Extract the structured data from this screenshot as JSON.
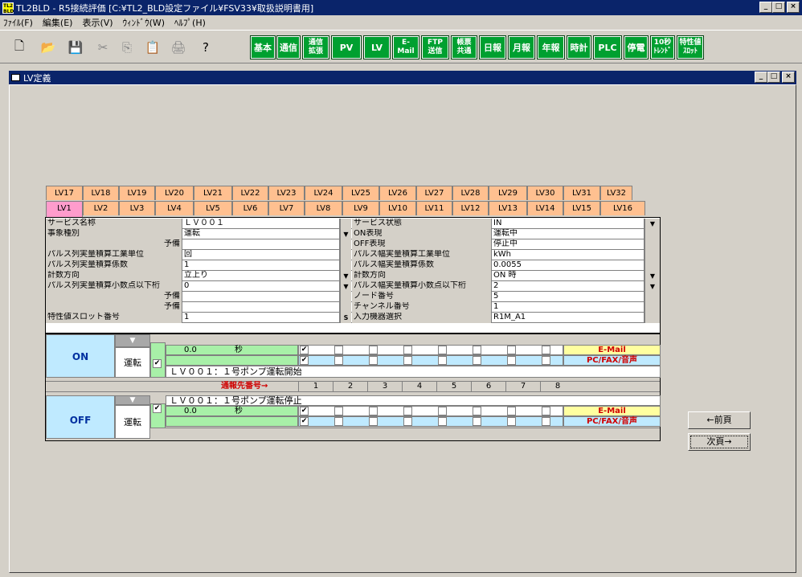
{
  "window": {
    "title": "TL2BLD - R5接続評価 [C:¥TL2_BLD設定ファイル¥FSV33¥取扱説明書用]",
    "icon_text": "TL2 BLD"
  },
  "menu": [
    "ﾌｧｲﾙ(F)",
    "編集(E)",
    "表示(V)",
    "ｳｨﾝﾄﾞｳ(W)",
    "ﾍﾙﾌﾟ(H)"
  ],
  "toolbar": {
    "icons": [
      "new-file-icon",
      "open-folder-icon",
      "save-icon",
      "cut-icon",
      "copy-icon",
      "paste-icon",
      "print-icon",
      "help-icon"
    ],
    "buttons": [
      "基本",
      "通信",
      "通信\n拡張",
      "PV",
      "LV",
      "E-\nMail",
      "FTP\n送信",
      "帳票\n共通",
      "日報",
      "月報",
      "年報",
      "時計",
      "PLC",
      "停電",
      "10秒\nﾄﾚﾝﾄﾞ",
      "特性値\nｽﾛｯﾄ"
    ]
  },
  "subwindow": {
    "title": "LV定義"
  },
  "tabs_top": [
    "LV17",
    "LV18",
    "LV19",
    "LV20",
    "LV21",
    "LV22",
    "LV23",
    "LV24",
    "LV25",
    "LV26",
    "LV27",
    "LV28",
    "LV29",
    "LV30",
    "LV31",
    "LV32"
  ],
  "tabs_bottom": [
    "LV1",
    "LV2",
    "LV3",
    "LV4",
    "LV5",
    "LV6",
    "LV7",
    "LV8",
    "LV9",
    "LV10",
    "LV11",
    "LV12",
    "LV13",
    "LV14",
    "LV15",
    "LV16"
  ],
  "left_rows": [
    {
      "label": "サービス名称",
      "value": "ＬＶ００１",
      "dd": false
    },
    {
      "label": "事象種別",
      "value": "運転",
      "dd": true
    },
    {
      "label": "予備",
      "value": "",
      "dd": false,
      "right": true
    },
    {
      "label": "パルス列実量積算工業単位",
      "value": "回",
      "dd": false
    },
    {
      "label": "パルス列実量積算係数",
      "value": "1",
      "dd": false
    },
    {
      "label": "計数方向",
      "value": "立上り",
      "dd": true
    },
    {
      "label": "パルス列実量積算小数点以下桁",
      "value": "0",
      "dd": true
    },
    {
      "label": "予備",
      "value": "",
      "dd": false,
      "right": true
    },
    {
      "label": "予備",
      "value": "",
      "dd": false,
      "right": true
    },
    {
      "label": "特性値スロット番号",
      "value": "1",
      "dd": false,
      "s": true
    }
  ],
  "right_rows": [
    {
      "label": "サービス状態",
      "value": "IN",
      "dd": true
    },
    {
      "label": "ON表現",
      "value": "運転中",
      "dd": false
    },
    {
      "label": "OFF表現",
      "value": "停止中",
      "dd": false
    },
    {
      "label": "パルス幅実量積算工業単位",
      "value": "kWh",
      "dd": false
    },
    {
      "label": "パルス幅実量積算係数",
      "value": "0.0055",
      "dd": false
    },
    {
      "label": "計数方向",
      "value": "ON 時",
      "dd": true
    },
    {
      "label": "パルス幅実量積算小数点以下桁",
      "value": "2",
      "dd": true
    },
    {
      "label": "ノード番号",
      "value": "5",
      "dd": false
    },
    {
      "label": "チャンネル番号",
      "value": "1",
      "dd": false
    },
    {
      "label": "入力機器選択",
      "value": "R1M_A1",
      "dd": false
    }
  ],
  "s_label": "S",
  "on_block": {
    "label": "ON",
    "state": "運転",
    "time": "0.0",
    "unit": "秒",
    "message": "ＬＶ００１：１号ポンプ運転開始"
  },
  "off_block": {
    "label": "OFF",
    "state": "運転",
    "time": "0.0",
    "unit": "秒",
    "message": "ＬＶ００１：１号ポンプ運転停止"
  },
  "notify": {
    "email": "E-Mail",
    "pcfax": "PC/FAX/音声",
    "dest_label": "通報先番号→",
    "numbers": [
      "1",
      "2",
      "3",
      "4",
      "5",
      "6",
      "7",
      "8"
    ]
  },
  "nav": {
    "prev": "←前頁",
    "next": "次頁→"
  }
}
